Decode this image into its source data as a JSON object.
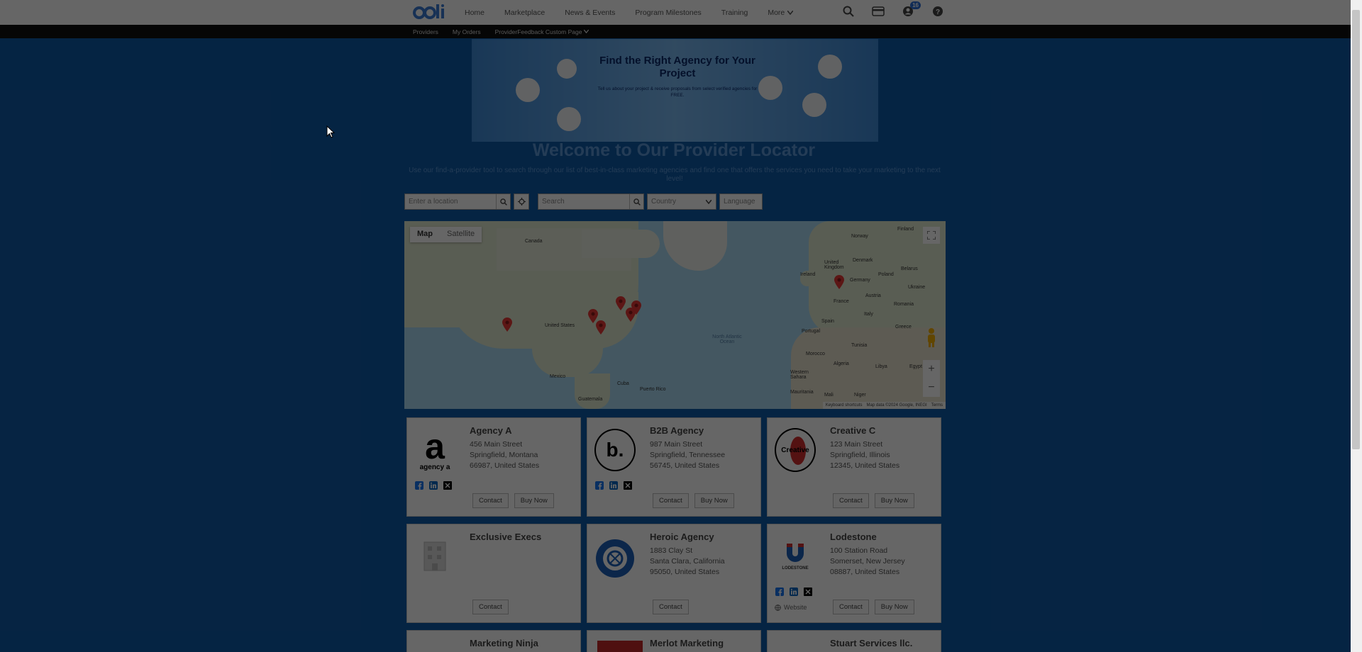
{
  "nav": {
    "links": [
      "Home",
      "Marketplace",
      "News & Events",
      "Program Milestones",
      "Training"
    ],
    "more": "More",
    "notification_count": "16"
  },
  "subnav": {
    "links": [
      "Providers",
      "My Orders",
      "ProviderFeedback Custom Page"
    ]
  },
  "banner": {
    "title": "Find the Right Agency for Your Project",
    "subtitle": "Tell us about your project & receive proposals from select verified agencies for FREE."
  },
  "page": {
    "title": "Welcome to Our Provider Locator",
    "intro": "Use our find-a-provider tool to search through our list of best-in-class marketing agencies and find one that offers the services you need to take your marketing to the next level!"
  },
  "search": {
    "location_placeholder": "Enter a location",
    "search_placeholder": "Search",
    "country": "Country",
    "language": "Language"
  },
  "map": {
    "tab_map": "Map",
    "tab_satellite": "Satellite",
    "labels": {
      "canada": "Canada",
      "us": "United States",
      "mexico": "Mexico",
      "cuba": "Cuba",
      "pr": "Puerto Rico",
      "guatemala": "Guatemala",
      "norway": "Norway",
      "finland": "Finland",
      "uk": "United Kingdom",
      "ireland": "Ireland",
      "denmark": "Denmark",
      "germany": "Germany",
      "poland": "Poland",
      "belarus": "Belarus",
      "ukraine": "Ukraine",
      "france": "France",
      "austria": "Austria",
      "romania": "Romania",
      "spain": "Spain",
      "italy": "Italy",
      "portugal": "Portugal",
      "greece": "Greece",
      "tunisia": "Tunisia",
      "morocco": "Morocco",
      "algeria": "Algeria",
      "libya": "Libya",
      "egypt": "Egypt",
      "western_sahara": "Western Sahara",
      "mauritania": "Mauritania",
      "mali": "Mali",
      "niger": "Niger",
      "atlantic": "North Atlantic Ocean"
    },
    "footer": [
      "Keyboard shortcuts",
      "Map data ©2024 Google, INEGI",
      "Terms"
    ]
  },
  "providers": [
    {
      "name": "Agency A",
      "street": "456 Main Street",
      "city": "Springfield, Montana",
      "zip": "66987, United States",
      "contact": "Contact",
      "buy": "Buy Now",
      "logo_text": "agency a"
    },
    {
      "name": "B2B Agency",
      "street": "987 Main Street",
      "city": "Springfield, Tennessee",
      "zip": "56745, United States",
      "contact": "Contact",
      "buy": "Buy Now",
      "logo_text": "b."
    },
    {
      "name": "Creative C",
      "street": "123 Main Street",
      "city": "Springfield, Illinois",
      "zip": "12345, United States",
      "contact": "Contact",
      "buy": "Buy Now",
      "logo_text": "Creative"
    },
    {
      "name": "Exclusive Execs",
      "contact": "Contact"
    },
    {
      "name": "Heroic Agency",
      "street": "1883 Clay St",
      "city": "Santa Clara, California",
      "zip": "95050, United States",
      "contact": "Contact"
    },
    {
      "name": "Lodestone",
      "street": "100 Station Road",
      "city": "Somerset, New Jersey",
      "zip": "08887, United States",
      "contact": "Contact",
      "buy": "Buy Now",
      "website": "Website",
      "logo_text": "LODESTONE"
    },
    {
      "name": "Marketing Ninja"
    },
    {
      "name": "Merlot Marketing"
    },
    {
      "name": "Stuart Services llc."
    }
  ]
}
